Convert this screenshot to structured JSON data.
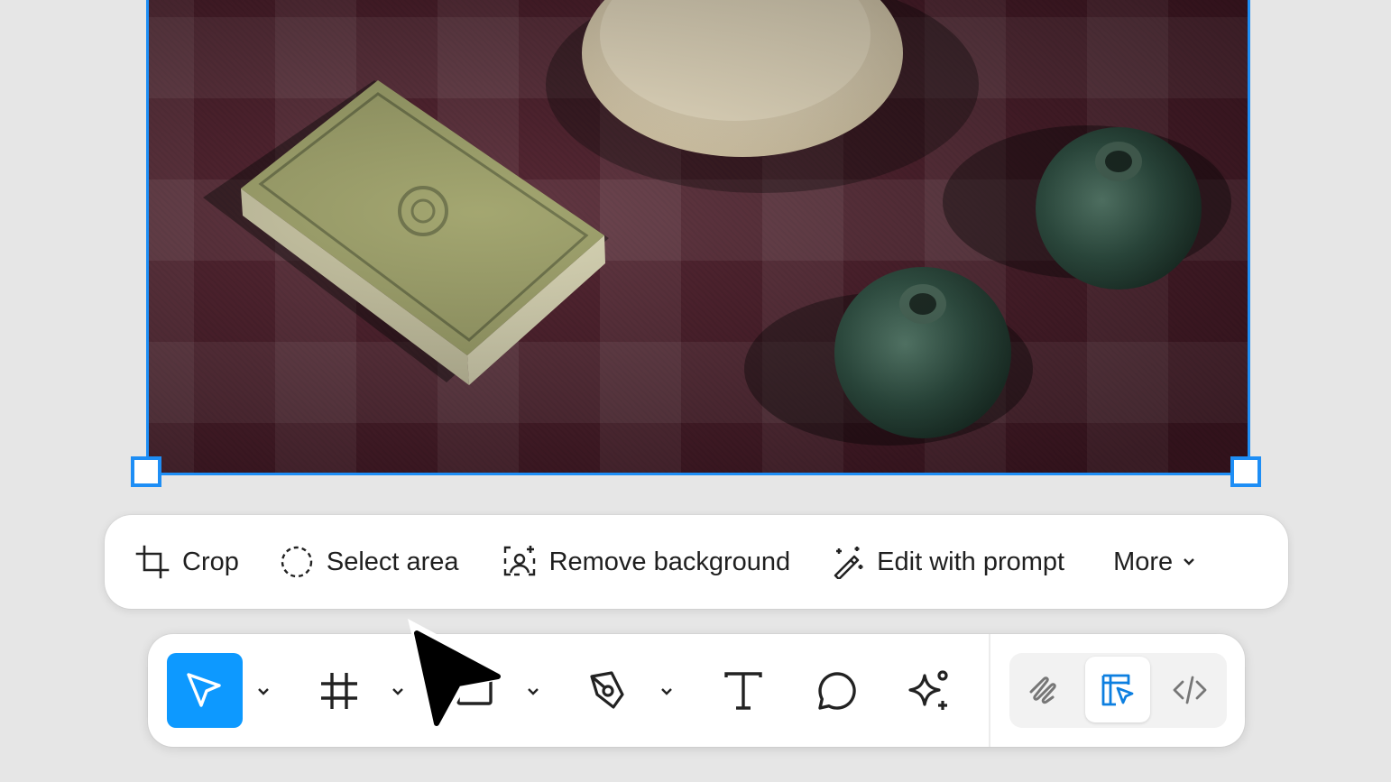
{
  "canvas": {
    "selection_color": "#1e8ef5",
    "image_description_icons": [
      "photo-placeholder"
    ]
  },
  "image_actions": {
    "crop": {
      "label": "Crop",
      "icon": "crop-icon"
    },
    "select_area": {
      "label": "Select area",
      "icon": "lasso-select-icon"
    },
    "remove_background": {
      "label": "Remove background",
      "icon": "remove-background-icon"
    },
    "edit_with_prompt": {
      "label": "Edit with prompt",
      "icon": "magic-wand-icon"
    },
    "more": {
      "label": "More",
      "icon": "chevron-down-icon"
    }
  },
  "toolbar": {
    "tools": [
      {
        "name": "move",
        "icon": "move-pointer-icon",
        "active": true
      },
      {
        "name": "frame",
        "icon": "frame-hash-icon"
      },
      {
        "name": "shape",
        "icon": "rectangle-icon"
      },
      {
        "name": "pen",
        "icon": "pen-nib-icon"
      },
      {
        "name": "text",
        "icon": "text-icon"
      },
      {
        "name": "comment",
        "icon": "comment-bubble-icon"
      },
      {
        "name": "actions",
        "icon": "ai-sparkle-icon"
      }
    ],
    "modes": [
      {
        "name": "draw",
        "icon": "draw-squiggle-icon"
      },
      {
        "name": "design",
        "icon": "design-mode-icon",
        "selected": true
      },
      {
        "name": "dev",
        "icon": "code-brackets-icon"
      }
    ],
    "accent": "#0d99ff"
  }
}
